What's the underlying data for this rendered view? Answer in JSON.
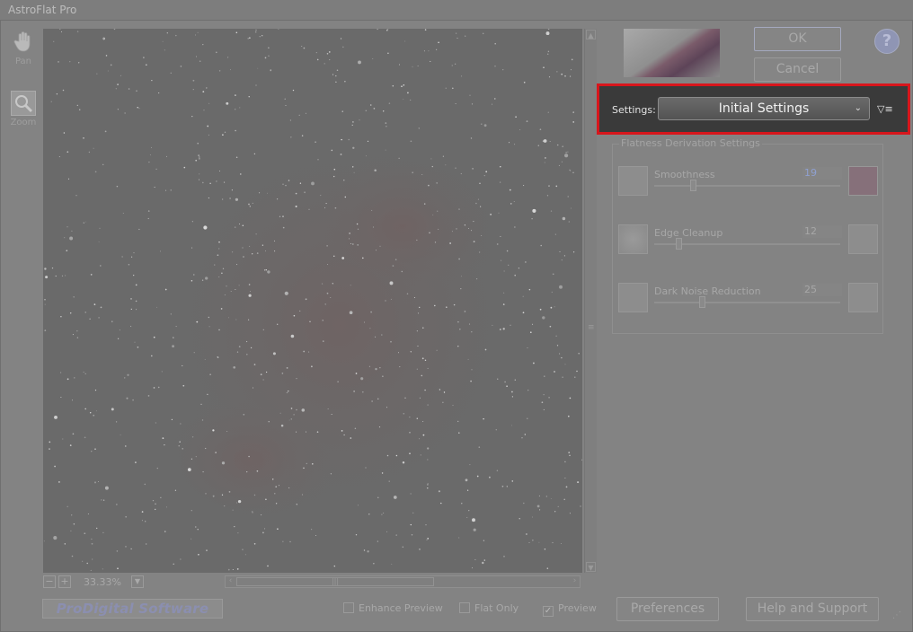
{
  "window": {
    "title": "AstroFlat Pro"
  },
  "tools": {
    "pan_label": "Pan",
    "zoom_label": "Zoom"
  },
  "viewer": {
    "zoom_value": "33.33%",
    "minus": "−",
    "plus": "+",
    "dropdown": "▼"
  },
  "buttons": {
    "ok": "OK",
    "cancel": "Cancel",
    "help": "?",
    "preferences": "Preferences",
    "help_support": "Help and Support"
  },
  "settings": {
    "label": "Settings:",
    "selected": "Initial Settings",
    "menu_icon": "▽≡"
  },
  "group": {
    "title": "Flatness Derivation Settings",
    "sliders": [
      {
        "label": "Smoothness",
        "value": "19",
        "level": 0.2
      },
      {
        "label": "Edge Cleanup",
        "value": "12",
        "level": 0.12
      },
      {
        "label": "Dark Noise Reduction",
        "value": "25",
        "level": 0.25
      }
    ]
  },
  "checkboxes": {
    "enhance": {
      "label": "Enhance Preview",
      "checked": false
    },
    "flat": {
      "label": "Flat Only",
      "checked": false
    },
    "preview": {
      "label": "Preview",
      "checked": true
    }
  },
  "brand": {
    "text": "ProDigital Software"
  },
  "colors": {
    "highlight_border": "#d8161c",
    "dimmed_background": "#838383",
    "settings_bar": "#3a3a3a"
  },
  "icons": {
    "pan": "hand-icon",
    "zoom": "magnifier-icon",
    "help": "question-icon",
    "settings_menu": "menu-icon"
  }
}
